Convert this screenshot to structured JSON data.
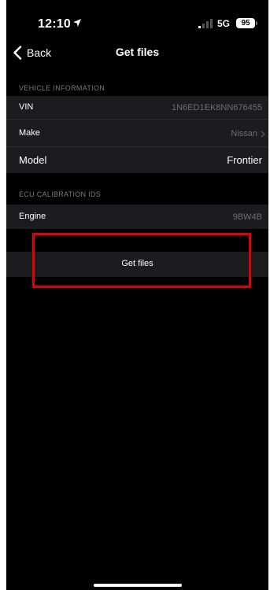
{
  "status_bar": {
    "time": "12:10",
    "network": "5G",
    "battery": "95"
  },
  "nav": {
    "back_label": "Back",
    "title": "Get files"
  },
  "vehicle_info": {
    "header": "VEHICLE INFORMATION",
    "rows": [
      {
        "label": "VIN",
        "value": "1N6ED1EK8NN676455"
      },
      {
        "label": "Make",
        "value": "Nissan"
      },
      {
        "label": "Model",
        "value": "Frontier"
      }
    ]
  },
  "ecu": {
    "header": "ECU CALIBRATION IDS",
    "rows": [
      {
        "label": "Engine",
        "value": "9BW4B"
      }
    ]
  },
  "actions": {
    "get_files_label": "Get files"
  },
  "colors": {
    "background": "#000000",
    "row_bg": "#1c1c1e",
    "highlight": "#e00000",
    "secondary_text": "#6e6e70"
  }
}
